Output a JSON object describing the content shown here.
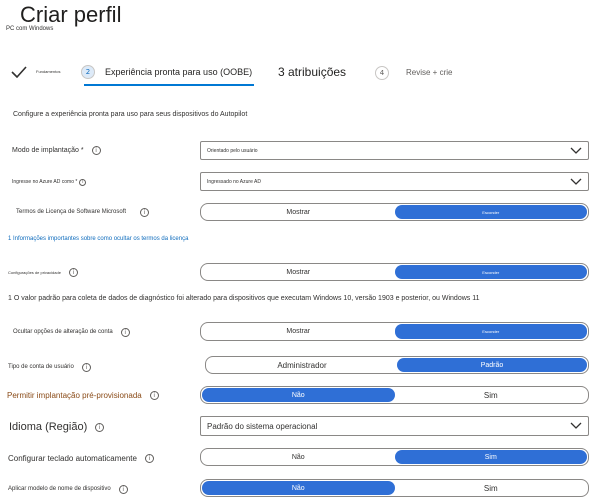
{
  "header": {
    "title": "Criar perfil",
    "subtitle": "PC com Windows"
  },
  "wizard": {
    "steps": [
      {
        "number": "",
        "label": "Fundamentos"
      },
      {
        "number": "2",
        "label": "Experiência pronta para uso (OOBE)"
      },
      {
        "number": "",
        "label": "3 atribuições"
      },
      {
        "number": "4",
        "label": "Revise + crie"
      }
    ]
  },
  "intro": "Configure a experiência pronta para uso para seus dispositivos do Autopilot",
  "form": {
    "deployment_mode": {
      "label": "Modo de implantação *",
      "value": "Orientado pelo usuário"
    },
    "join_azure": {
      "label": "Ingresse no Azure AD como * ",
      "value": "Ingressado no Azure AD"
    },
    "license_terms": {
      "label": "Termos de Licença de Software Microsoft",
      "options": [
        "Mostrar",
        "Esconder"
      ],
      "selected": "Esconder"
    },
    "license_note": "1 Informações importantes sobre como ocultar os termos da licença",
    "privacy": {
      "label": "Configurações de privacidade",
      "options": [
        "Mostrar",
        "Esconder"
      ],
      "selected": "Esconder"
    },
    "diagnostic_note": "1 O valor padrão para coleta de dados de diagnóstico foi alterado para dispositivos que executam Windows 10, versão 1903 e posterior, ou Windows 11",
    "hide_account_change": {
      "label": "Ocultar opções de alteração de conta",
      "options": [
        "Mostrar",
        "Esconder"
      ],
      "selected": "Esconder"
    },
    "user_account_type": {
      "label": "Tipo de conta de usuário",
      "options": [
        "Administrador",
        "Padrão"
      ],
      "selected": "Padrão"
    },
    "preprovisioned": {
      "label": "Permitir implantação pré-provisionada",
      "options": [
        "Não",
        "Sim"
      ],
      "selected": "Não"
    },
    "language": {
      "label": "Idioma (Região)",
      "value": "Padrão do sistema operacional"
    },
    "keyboard": {
      "label": "Configurar teclado automaticamente",
      "options": [
        "Não",
        "Sim"
      ],
      "selected": "Sim"
    },
    "device_name": {
      "label": "Aplicar modelo de nome de dispositivo",
      "options": [
        "Não",
        "Sim"
      ],
      "selected": "Não"
    }
  },
  "icons": {
    "info": "info-icon",
    "chevron": "chevron-down-icon",
    "check": "checkmark-icon"
  },
  "colors": {
    "accent": "#2f6fd6",
    "link": "#0f6cbd",
    "underline": "#0078d4"
  }
}
